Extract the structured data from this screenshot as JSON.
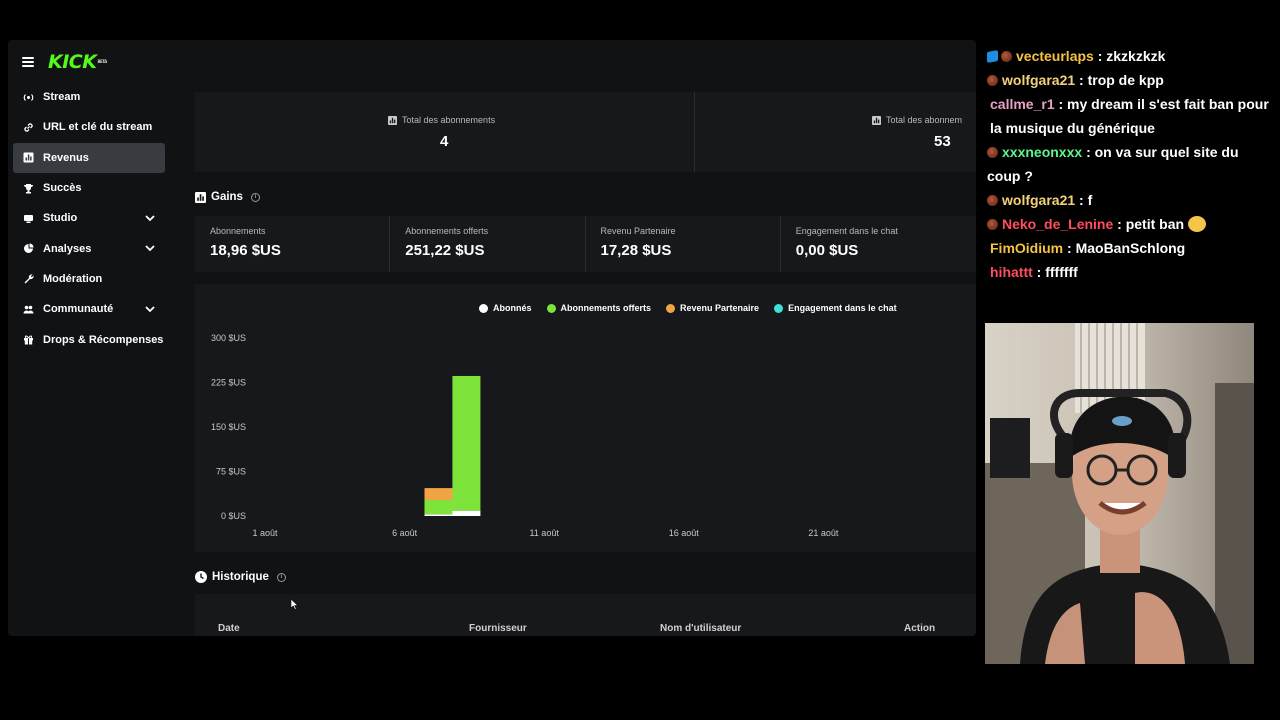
{
  "brand": {
    "logo": "KICK",
    "tag": "BETA"
  },
  "sidebar": {
    "items": [
      {
        "label": "Stream",
        "icon": "broadcast-icon",
        "active": false,
        "expandable": false
      },
      {
        "label": "URL et clé du stream",
        "icon": "link-icon",
        "active": false,
        "expandable": false
      },
      {
        "label": "Revenus",
        "icon": "bar-chart-icon",
        "active": true,
        "expandable": false
      },
      {
        "label": "Succès",
        "icon": "trophy-icon",
        "active": false,
        "expandable": false
      },
      {
        "label": "Studio",
        "icon": "studio-icon",
        "active": false,
        "expandable": true
      },
      {
        "label": "Analyses",
        "icon": "analytics-icon",
        "active": false,
        "expandable": true
      },
      {
        "label": "Modération",
        "icon": "wrench-icon",
        "active": false,
        "expandable": false
      },
      {
        "label": "Communauté",
        "icon": "community-icon",
        "active": false,
        "expandable": true
      },
      {
        "label": "Drops & Récompenses",
        "icon": "gift-icon",
        "active": false,
        "expandable": false
      }
    ]
  },
  "totals": [
    {
      "label": "Total des abonnements",
      "value": "4"
    },
    {
      "label": "Total des abonnem",
      "value": "53"
    }
  ],
  "gains": {
    "title": "Gains",
    "cards": [
      {
        "label": "Abonnements",
        "value": "18,96 $US"
      },
      {
        "label": "Abonnements offerts",
        "value": "251,22 $US"
      },
      {
        "label": "Revenu Partenaire",
        "value": "17,28 $US"
      },
      {
        "label": "Engagement dans le chat",
        "value": "0,00 $US"
      }
    ]
  },
  "colors": {
    "subs": "#ffffff",
    "gifted": "#7ee33b",
    "partner": "#f2a444",
    "chat": "#3fe0d8",
    "accent": "#53fc18"
  },
  "chart_data": {
    "type": "bar",
    "stacked": true,
    "series": [
      {
        "name": "Abonnés",
        "color": "#ffffff",
        "points": [
          [
            7,
            3
          ],
          [
            8,
            9
          ]
        ]
      },
      {
        "name": "Abonnements offerts",
        "color": "#7ee33b",
        "points": [
          [
            7,
            24
          ],
          [
            8,
            227
          ]
        ]
      },
      {
        "name": "Revenu Partenaire",
        "color": "#f2a444",
        "points": [
          [
            7,
            20
          ],
          [
            8,
            0
          ]
        ]
      },
      {
        "name": "Engagement dans le chat",
        "color": "#3fe0d8",
        "points": [
          [
            7,
            0
          ],
          [
            8,
            0
          ]
        ]
      }
    ],
    "x_ticks": [
      {
        "day": 1,
        "label": "1 août"
      },
      {
        "day": 6,
        "label": "6 août"
      },
      {
        "day": 11,
        "label": "11 août"
      },
      {
        "day": 16,
        "label": "16 août"
      },
      {
        "day": 21,
        "label": "21 août"
      }
    ],
    "y_ticks": [
      {
        "value": 0,
        "label": "0 $US"
      },
      {
        "value": 75,
        "label": "75 $US"
      },
      {
        "value": 150,
        "label": "150 $US"
      },
      {
        "value": 225,
        "label": "225 $US"
      },
      {
        "value": 300,
        "label": "300 $US"
      }
    ],
    "ylim": [
      0,
      300
    ],
    "legend_position": "top",
    "grid": false
  },
  "history": {
    "title": "Historique",
    "columns": [
      "Date",
      "Fournisseur",
      "Nom d'utilisateur",
      "Action"
    ]
  },
  "chat": [
    {
      "badge": "cube",
      "user": "vecteurlaps",
      "color": "#f5c242",
      "text": ": zkzkzkzk"
    },
    {
      "badge": "dot",
      "user": "wolfgara21",
      "color": "#f5d27a",
      "text": ": trop de kpp"
    },
    {
      "badge": "none",
      "user": "callme_r1",
      "color": "#e9a0c8",
      "text": ": my dream il s'est fait ban pour la musique du générique"
    },
    {
      "badge": "dot",
      "user": "xxxneonxxx",
      "color": "#5df58e",
      "text": ": on va sur quel site du coup ?"
    },
    {
      "badge": "dot",
      "user": "wolfgara21",
      "color": "#f5d27a",
      "text": ": f"
    },
    {
      "badge": "dot",
      "user": "Neko_de_Lenine",
      "color": "#ff4d5e",
      "text": ": petit ban",
      "emote": "emote-face"
    },
    {
      "badge": "none",
      "user": "FimOidium",
      "color": "#f5c242",
      "text": ": MaoBanSchlong"
    },
    {
      "badge": "none",
      "user": "hihattt",
      "color": "#ff4d5e",
      "text": ": fffffff"
    }
  ]
}
